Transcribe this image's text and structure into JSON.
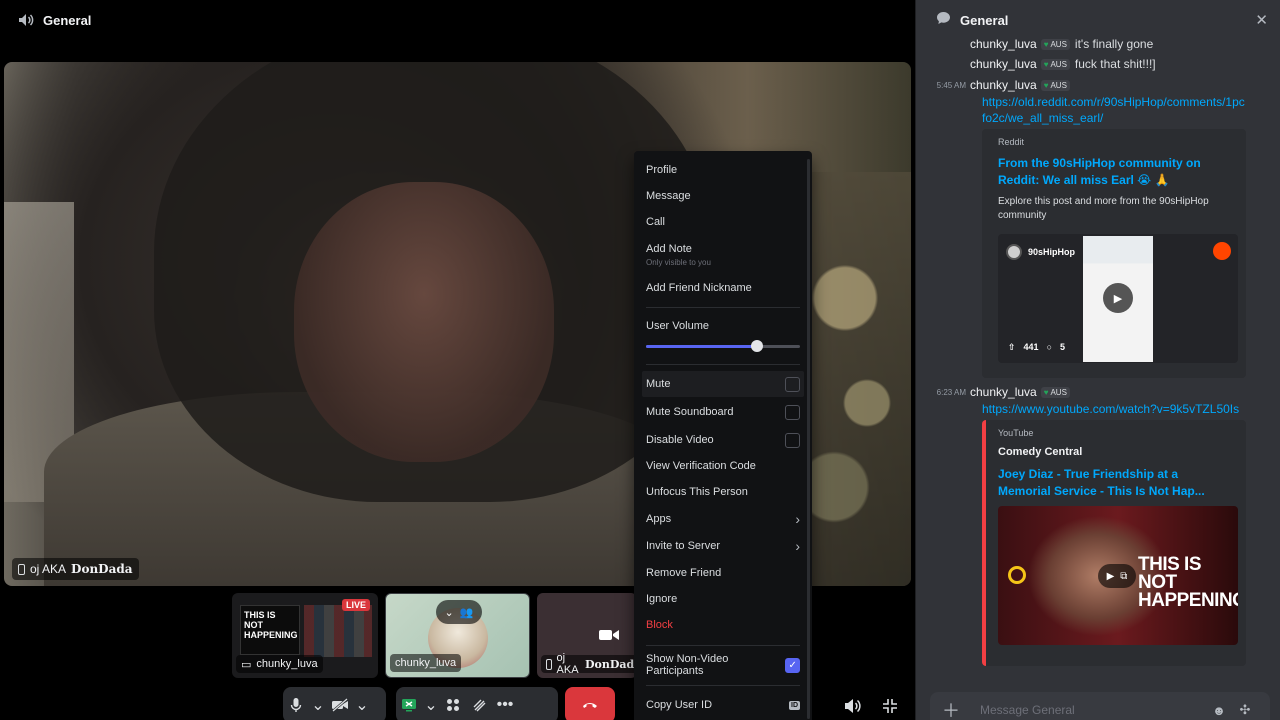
{
  "stage": {
    "channel_title": "General",
    "main_participant": {
      "name_prefix": "oj AKA ",
      "name_styled": "DonDada"
    },
    "thumbnails": [
      {
        "name": "chunky_luva",
        "badge": "LIVE",
        "screen_text": "THIS IS NOT HAPPENING"
      },
      {
        "name": "chunky_luva"
      },
      {
        "name_prefix": "oj AKA ",
        "name_styled": "DonDada"
      }
    ]
  },
  "context_menu": {
    "items": [
      {
        "label": "Profile"
      },
      {
        "label": "Message"
      },
      {
        "label": "Call"
      },
      {
        "label": "Add Note",
        "sublabel": "Only visible to you"
      },
      {
        "label": "Add Friend Nickname"
      },
      {
        "label": "User Volume"
      },
      {
        "label": "Mute",
        "checked": false
      },
      {
        "label": "Mute Soundboard",
        "checked": false
      },
      {
        "label": "Disable Video",
        "checked": false
      },
      {
        "label": "View Verification Code"
      },
      {
        "label": "Unfocus This Person"
      },
      {
        "label": "Apps"
      },
      {
        "label": "Invite to Server"
      },
      {
        "label": "Remove Friend"
      },
      {
        "label": "Ignore"
      },
      {
        "label": "Block"
      },
      {
        "label": "Show Non-Video Participants",
        "checked": true
      },
      {
        "label": "Copy User ID",
        "badge": "ID"
      }
    ],
    "user_volume_fraction": 0.72
  },
  "chat": {
    "title": "General",
    "messages": [
      {
        "user": "chunky_luva",
        "tag": "AUS",
        "text": "it's finally gone"
      },
      {
        "user": "chunky_luva",
        "tag": "AUS",
        "text": "fuck that shit!!!]"
      },
      {
        "time": "5:45 AM",
        "user": "chunky_luva",
        "tag": "AUS",
        "link": "https://old.reddit.com/r/90sHipHop/comments/1pcfo2c/we_all_miss_earl/"
      },
      {
        "time": "6:23 AM",
        "user": "chunky_luva",
        "tag": "AUS",
        "link": "https://www.youtube.com/watch?v=9k5vTZL50Is"
      }
    ],
    "reddit_embed": {
      "provider": "Reddit",
      "title": "From the 90sHipHop community on Reddit: We all miss Earl 😭 🙏",
      "description": "Explore this post and more from the 90sHipHop community",
      "community": "90sHipHop",
      "upvotes": "441",
      "comments": "5"
    },
    "youtube_embed": {
      "provider": "YouTube",
      "author": "Comedy Central",
      "title": "Joey Diaz - True Friendship at a Memorial Service - This Is Not Hap...",
      "thumb_text": "THIS IS NOT HAPPENING"
    },
    "composer_placeholder": "Message General"
  },
  "colors": {
    "accent": "#5865f2",
    "danger": "#f23f43",
    "link": "#00a8fc",
    "live": "#da373c"
  }
}
